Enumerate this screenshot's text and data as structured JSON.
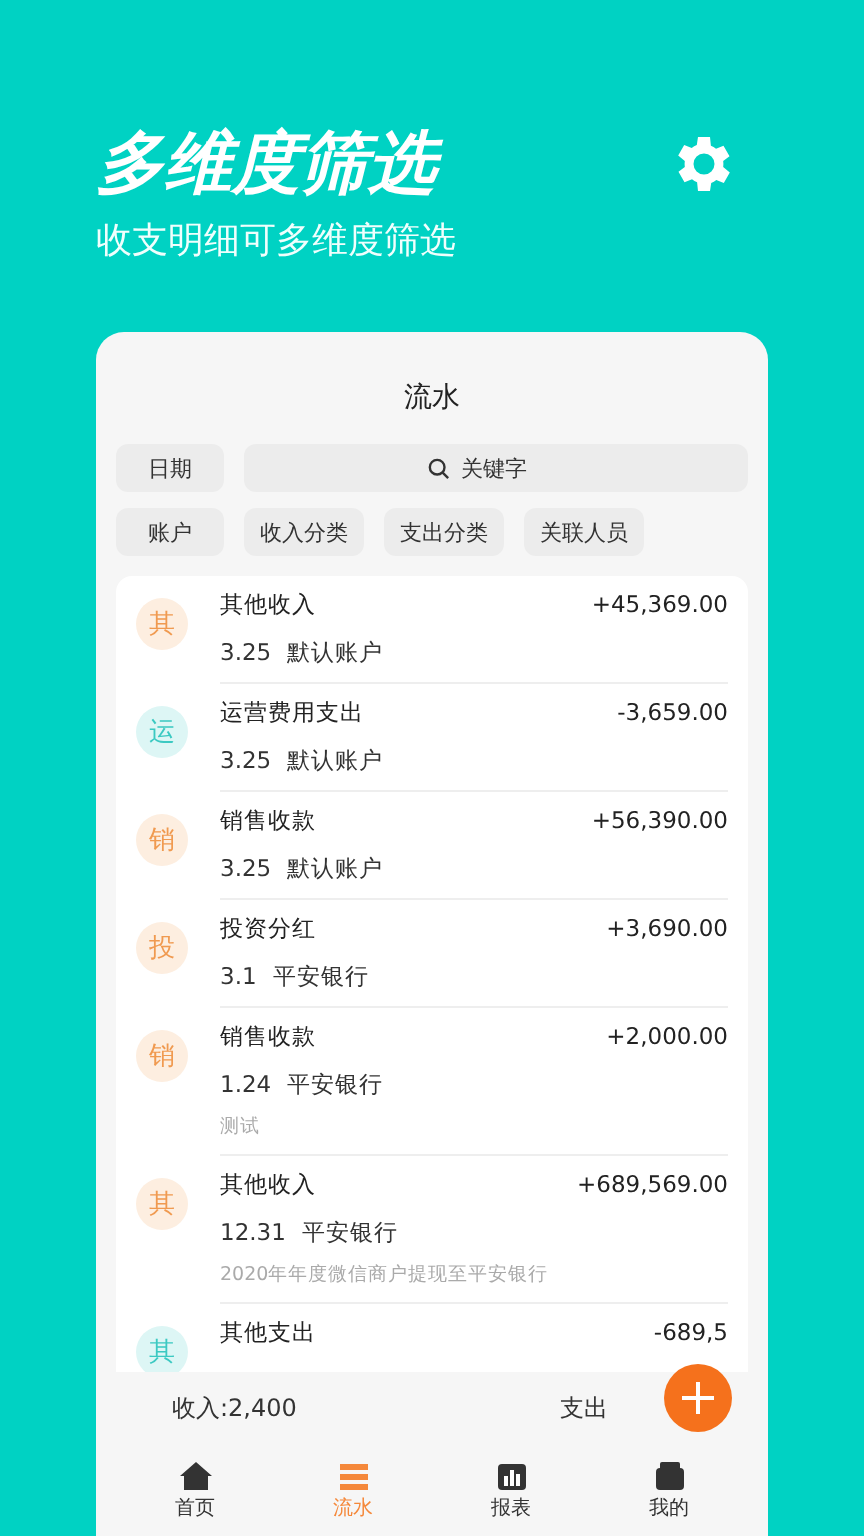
{
  "header": {
    "title": "多维度筛选",
    "subtitle": "收支明细可多维度筛选"
  },
  "card": {
    "title": "流水",
    "filters": {
      "date": "日期",
      "search": {
        "placeholder": "关键字"
      },
      "chips": [
        "账户",
        "收入分类",
        "支出分类",
        "关联人员"
      ]
    },
    "entries": [
      {
        "kind": "income",
        "avatar": "其",
        "name": "其他收入",
        "amount": "+45,369.00",
        "date": "3.25",
        "account": "默认账户"
      },
      {
        "kind": "expense",
        "avatar": "运",
        "name": "运营费用支出",
        "amount": "-3,659.00",
        "date": "3.25",
        "account": "默认账户"
      },
      {
        "kind": "income",
        "avatar": "销",
        "name": "销售收款",
        "amount": "+56,390.00",
        "date": "3.25",
        "account": "默认账户"
      },
      {
        "kind": "income",
        "avatar": "投",
        "name": "投资分红",
        "amount": "+3,690.00",
        "date": "3.1",
        "account": "平安银行"
      },
      {
        "kind": "income",
        "avatar": "销",
        "name": "销售收款",
        "amount": "+2,000.00",
        "date": "1.24",
        "account": "平安银行",
        "note": "测试"
      },
      {
        "kind": "income",
        "avatar": "其",
        "name": "其他收入",
        "amount": "+689,569.00",
        "date": "12.31",
        "account": "平安银行",
        "note": "2020年年度微信商户提现至平安银行"
      },
      {
        "kind": "expense",
        "avatar": "其",
        "name": "其他支出",
        "amount": "-689,5"
      }
    ],
    "summary": {
      "income": "收入:2,400",
      "expense": "支出"
    },
    "tabs": [
      {
        "label": "首页",
        "selected": false
      },
      {
        "label": "流水",
        "selected": true
      },
      {
        "label": "报表",
        "selected": false
      },
      {
        "label": "我的",
        "selected": false
      }
    ]
  }
}
